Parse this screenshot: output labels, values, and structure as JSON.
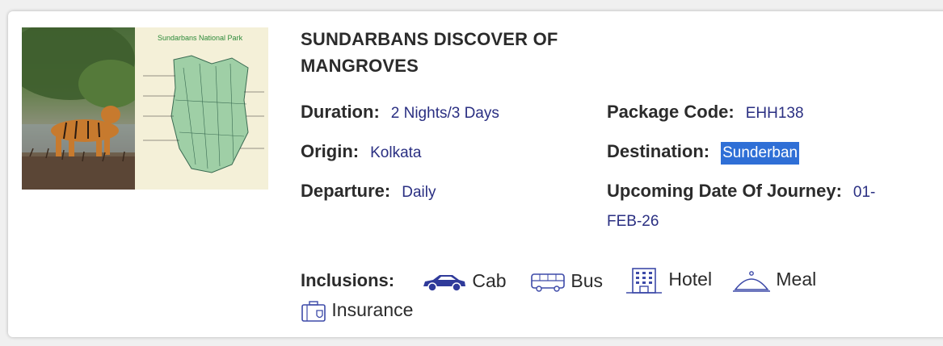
{
  "package": {
    "title": "SUNDARBANS DISCOVER OF MANGROVES",
    "image": {
      "map_title": "Sundarbans National Park",
      "icon": "tiger-and-map-image"
    },
    "duration_label": "Duration:",
    "duration_value": "2 Nights/3 Days",
    "package_code_label": "Package Code:",
    "package_code_value": "EHH138",
    "origin_label": "Origin:",
    "origin_value": "Kolkata",
    "destination_label": "Destination:",
    "destination_value": "Sunderban",
    "departure_label": "Departure:",
    "departure_value": "Daily",
    "udoj_label": "Upcoming Date Of Journey:",
    "udoj_value_part1": "01-",
    "udoj_value_part2": "FEB-26"
  },
  "inclusions": {
    "label": "Inclusions:",
    "items": [
      {
        "label": "Cab",
        "icon": "car-icon"
      },
      {
        "label": "Bus",
        "icon": "bus-icon"
      },
      {
        "label": "Hotel",
        "icon": "hotel-icon"
      },
      {
        "label": "Meal",
        "icon": "cloche-icon"
      },
      {
        "label": "Insurance",
        "icon": "insurance-icon"
      }
    ]
  },
  "colors": {
    "value_text": "#2a2f82",
    "label_text": "#2b2b2b",
    "icon_color": "#3d4aa8",
    "highlight": "#2f6fd6"
  }
}
